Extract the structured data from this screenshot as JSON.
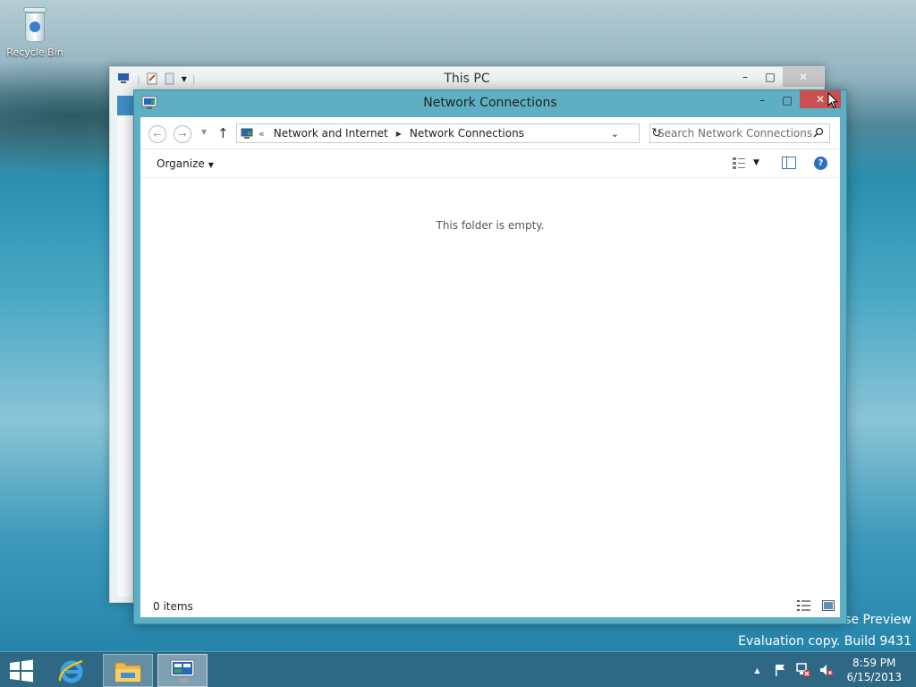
{
  "desktop": {
    "recycle_bin_label": "Recycle Bin",
    "watermark_line1": "ise Preview",
    "watermark_line2": "Evaluation copy. Build 9431"
  },
  "back_window": {
    "title": "This PC",
    "caption": {
      "minimize": "–",
      "maximize": "□",
      "close": "✕"
    }
  },
  "window": {
    "title": "Network Connections",
    "caption": {
      "minimize": "–",
      "maximize": "□",
      "close": "✕"
    },
    "nav": {
      "back": "←",
      "forward": "→",
      "recent": "▼",
      "up": "↑"
    },
    "address": {
      "overflow": "«",
      "crumbs": [
        "Network and Internet",
        "Network Connections"
      ],
      "dropdown": "⌄",
      "refresh": "↻"
    },
    "search": {
      "placeholder": "Search Network Connections"
    },
    "command_bar": {
      "organize": "Organize"
    },
    "content": {
      "empty_message": "This folder is empty."
    },
    "status": {
      "items": "0 items"
    },
    "help": "?"
  },
  "taskbar": {
    "clock_time": "8:59 PM",
    "clock_date": "6/15/2013",
    "tray_overflow": "▲"
  },
  "colors": {
    "window_frame": "#5eafc4",
    "close_button": "#c75050",
    "taskbar": "#306681",
    "accent_blue": "#2f6fc0"
  },
  "icons": [
    "recycle-bin-icon",
    "network-connections-icon",
    "search-icon",
    "help-icon",
    "preview-pane-icon",
    "change-view-icon",
    "details-view-icon",
    "large-icons-view-icon",
    "windows-start-icon",
    "internet-explorer-icon",
    "file-explorer-icon",
    "action-center-flag-icon",
    "network-status-icon",
    "volume-muted-icon",
    "mouse-cursor"
  ]
}
